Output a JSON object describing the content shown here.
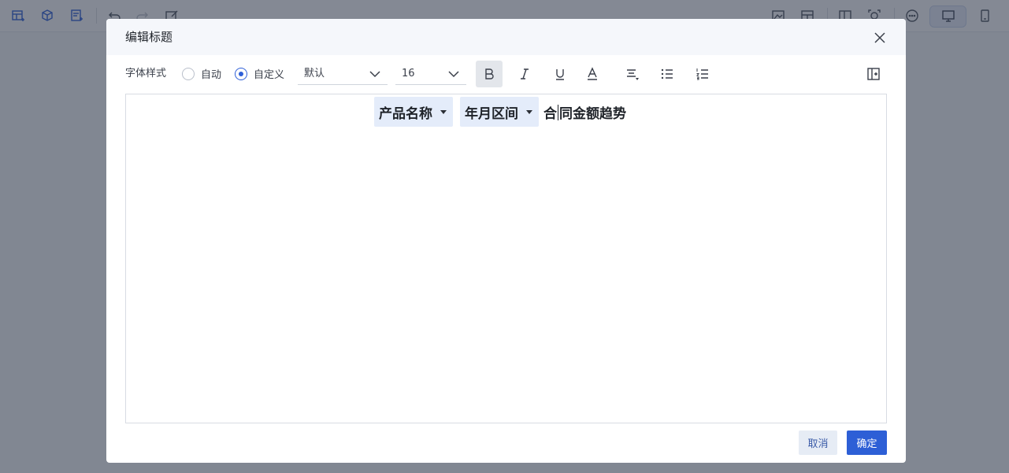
{
  "dialog": {
    "title": "编辑标题",
    "cancel_label": "取消",
    "ok_label": "确定"
  },
  "format_bar": {
    "font_style_label": "字体样式",
    "radio_auto": "自动",
    "radio_custom": "自定义",
    "selected_mode": "自定义",
    "font_family_value": "默认",
    "font_size_value": "16",
    "bold_active": true
  },
  "editor": {
    "chip_1": "产品名称",
    "chip_2": "年月区间",
    "text_before_caret": "合",
    "text_after_caret": "同金额趋势"
  },
  "colors": {
    "primary": "#2d5fd6",
    "chip_bg": "#e4ecfa",
    "overlay": "#283040"
  }
}
